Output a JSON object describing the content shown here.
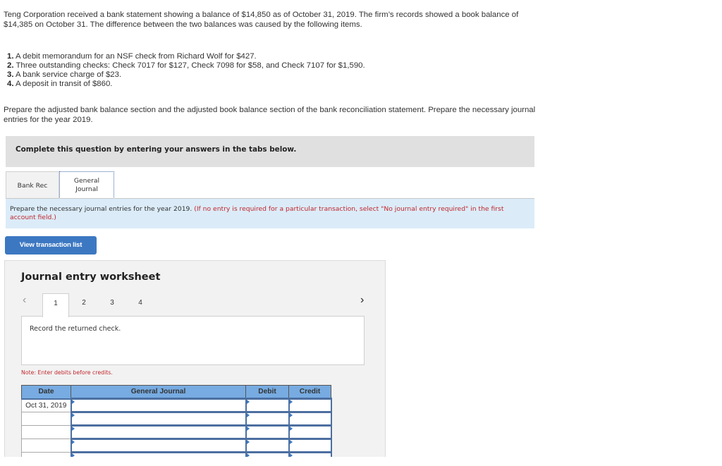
{
  "problem": {
    "intro": "Teng Corporation received a bank statement showing a balance of $14,850 as of October 31, 2019. The firm’s records showed a book balance of $14,385 on October 31. The difference between the two balances was caused by the following items.",
    "items": [
      {
        "num": "1.",
        "text": "A debit memorandum for an NSF check from Richard Wolf for $427."
      },
      {
        "num": "2.",
        "text": "Three outstanding checks: Check 7017 for $127, Check 7098 for $58, and Check 7107 for $1,590."
      },
      {
        "num": "3.",
        "text": "A bank service charge of $23."
      },
      {
        "num": "4.",
        "text": "A deposit in transit of $860."
      }
    ],
    "instructions": "Prepare the adjusted bank balance section and the adjusted book balance section of the bank reconciliation statement. Prepare the necessary journal entries for the year 2019."
  },
  "complete_banner": "Complete this question by entering your answers in the tabs below.",
  "tabs": [
    {
      "label": "Bank Rec",
      "active": false
    },
    {
      "label_line1": "General",
      "label_line2": "Journal",
      "active": true
    }
  ],
  "info": {
    "text": "Prepare the necessary journal entries for the year 2019.",
    "red_text": "(If no entry is required for a particular transaction, select \"No journal entry required\" in the first account field.)"
  },
  "view_button": "View transaction list",
  "worksheet": {
    "title": "Journal entry worksheet",
    "prev_icon": "‹",
    "next_icon": "›",
    "steps": [
      "1",
      "2",
      "3",
      "4"
    ],
    "active_step": 1,
    "description": "Record the returned check.",
    "note": "Note: Enter debits before credits.",
    "columns": [
      "Date",
      "General Journal",
      "Debit",
      "Credit"
    ],
    "rows": [
      {
        "date": "Oct 31, 2019",
        "account": "",
        "debit": "",
        "credit": ""
      },
      {
        "date": "",
        "account": "",
        "debit": "",
        "credit": ""
      },
      {
        "date": "",
        "account": "",
        "debit": "",
        "credit": ""
      },
      {
        "date": "",
        "account": "",
        "debit": "",
        "credit": ""
      },
      {
        "date": "",
        "account": "",
        "debit": "",
        "credit": ""
      }
    ]
  },
  "colors": {
    "button_blue": "#3c78c2",
    "header_blue": "#77abe1",
    "info_bg": "#dbecf8",
    "note_red": "#c0272d"
  }
}
